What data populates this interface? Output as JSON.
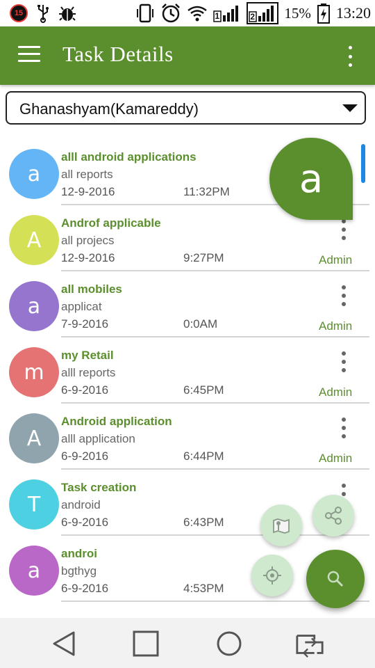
{
  "status_bar": {
    "notification_count": "15",
    "battery_percent": "15%",
    "time": "13:20",
    "sim1_label": "1",
    "sim2_label": "2"
  },
  "app_bar": {
    "title": "Task Details"
  },
  "selector": {
    "selected_value": "Ghanashyam(Kamareddy)"
  },
  "tasks": [
    {
      "initial": "a",
      "avatar_color": "#64b5f6",
      "title": "alll android applications",
      "subtitle": "all reports",
      "date": "12-9-2016",
      "time": "11:32PM",
      "role": ""
    },
    {
      "initial": "A",
      "avatar_color": "#d4e157",
      "title": "Androf applicable",
      "subtitle": "all projecs",
      "date": "12-9-2016",
      "time": "9:27PM",
      "role": "Admin"
    },
    {
      "initial": "a",
      "avatar_color": "#9575cd",
      "title": "all mobiles",
      "subtitle": "applicat",
      "date": "7-9-2016",
      "time": "0:0AM",
      "role": "Admin"
    },
    {
      "initial": "m",
      "avatar_color": "#e57373",
      "title": "my Retail",
      "subtitle": "alll reports",
      "date": "6-9-2016",
      "time": "6:45PM",
      "role": "Admin"
    },
    {
      "initial": "A",
      "avatar_color": "#90a4ae",
      "title": "Android application",
      "subtitle": "alll application",
      "date": "6-9-2016",
      "time": "6:44PM",
      "role": "Admin"
    },
    {
      "initial": "T",
      "avatar_color": "#4dd0e1",
      "title": "Task creation",
      "subtitle": "android",
      "date": "6-9-2016",
      "time": "6:43PM",
      "role": ""
    },
    {
      "initial": "a",
      "avatar_color": "#ba68c8",
      "title": "androi",
      "subtitle": "bgthyg",
      "date": "6-9-2016",
      "time": "4:53PM",
      "role": ""
    }
  ],
  "fast_scroll_letter": "a",
  "colors": {
    "primary": "#5b8f2d",
    "fab_mini": "#cfe9cf",
    "scroll_indicator": "#1e88e5"
  },
  "fab_icons": {
    "main": "search-icon",
    "mini": [
      "map-icon",
      "share-icon",
      "location-icon"
    ]
  },
  "nav_icons": [
    "back-icon",
    "home-icon",
    "recents-icon",
    "switch-icon"
  ]
}
